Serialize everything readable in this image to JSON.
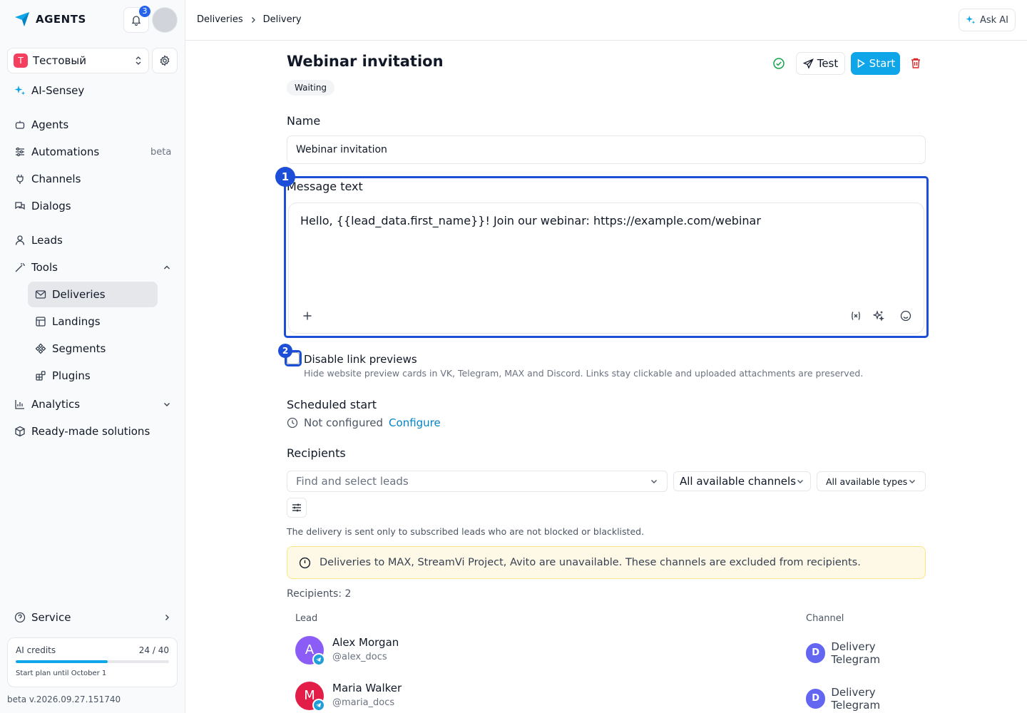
{
  "brand": {
    "name": "AGENTS"
  },
  "notifications": {
    "count": "3"
  },
  "workspace": {
    "letter": "T",
    "name": "Тестовый"
  },
  "sidebar": {
    "items": [
      {
        "label": "AI-Sensey"
      },
      {
        "label": "Agents"
      },
      {
        "label": "Automations",
        "badge": "beta"
      },
      {
        "label": "Channels"
      },
      {
        "label": "Dialogs"
      },
      {
        "label": "Leads"
      },
      {
        "label": "Tools"
      },
      {
        "label": "Deliveries"
      },
      {
        "label": "Landings"
      },
      {
        "label": "Segments"
      },
      {
        "label": "Plugins"
      },
      {
        "label": "Analytics"
      },
      {
        "label": "Ready-made solutions"
      },
      {
        "label": "Service"
      }
    ]
  },
  "credits": {
    "label": "AI credits",
    "value": "24 / 40",
    "fraction": 0.6,
    "plan": "Start plan until October 1"
  },
  "version": "beta v.2026.09.27.151740",
  "breadcrumb": {
    "parent": "Deliveries",
    "current": "Delivery"
  },
  "ask_ai": "Ask AI",
  "delivery": {
    "title": "Webinar invitation",
    "status": "Waiting",
    "test_label": "Test",
    "start_label": "Start",
    "name_label": "Name",
    "name_value": "Webinar invitation",
    "message_label": "Message text",
    "message_value": "Hello, {{lead_data.first_name}}! Join our webinar: https://example.com/webinar",
    "link_preview_label": "Disable link previews",
    "link_preview_desc": "Hide website preview cards in VK, Telegram, MAX and Discord. Links stay clickable and uploaded attachments are preserved.",
    "schedule_label": "Scheduled start",
    "schedule_status": "Not configured",
    "schedule_action": "Configure",
    "recipients_label": "Recipients",
    "leads_placeholder": "Find and select leads",
    "channels_value": "All available channels",
    "types_value": "All available types",
    "note": "The delivery is sent only to subscribed leads who are not blocked or blacklisted.",
    "warning": "Deliveries to MAX, StreamVi Project, Avito are unavailable. These channels are excluded from recipients.",
    "recipients_count": "Recipients: 2",
    "table_headers": {
      "lead": "Lead",
      "channel": "Channel"
    },
    "recipients": [
      {
        "initial": "A",
        "name": "Alex Morgan",
        "handle": "@alex_docs",
        "channel_initial": "D",
        "channel": "Delivery Telegram",
        "color": "#8b5cf6"
      },
      {
        "initial": "M",
        "name": "Maria Walker",
        "handle": "@maria_docs",
        "channel_initial": "D",
        "channel": "Delivery Telegram",
        "color": "#e11d48"
      }
    ]
  },
  "highlights": {
    "first": "1",
    "second": "2"
  }
}
